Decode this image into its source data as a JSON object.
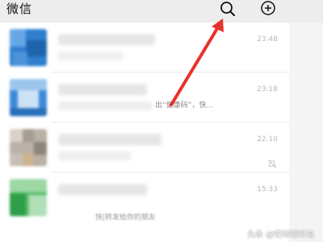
{
  "header": {
    "title": "微信",
    "search_icon": "search-icon",
    "add_icon": "plus-circle-icon"
  },
  "chats": [
    {
      "time": "23:48",
      "preview": ""
    },
    {
      "time": "23:18",
      "preview": "出“健康码”，快..."
    },
    {
      "time": "22:10",
      "preview": "",
      "muted": true
    },
    {
      "time": "15:33",
      "preview": "快|转发给你的朋友"
    }
  ],
  "annotation": {
    "color": "#e8312a"
  },
  "watermark": {
    "text": "头条 @哎哟喂听说"
  }
}
